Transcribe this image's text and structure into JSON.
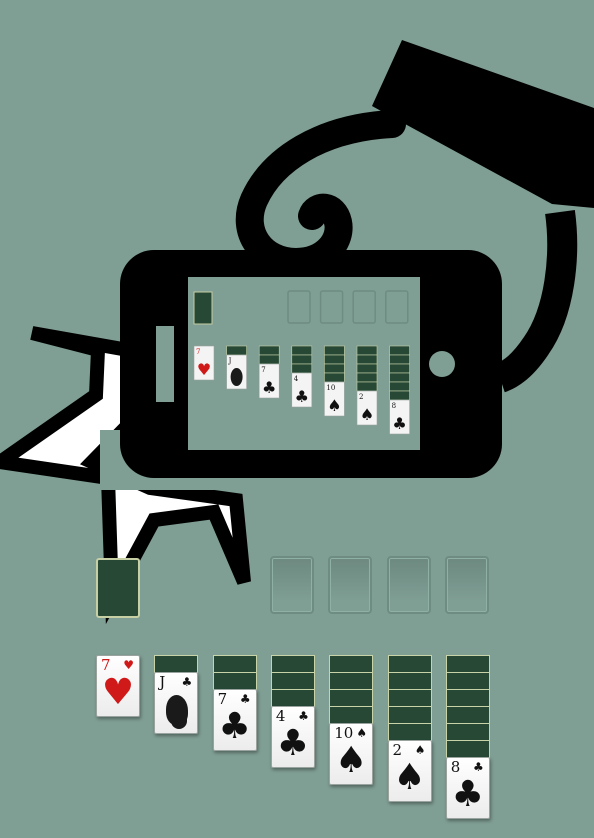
{
  "theme": {
    "felt": "#7f9e94",
    "card_back": "#264835",
    "red_suit": "#d01a1a",
    "black_suit": "#111111",
    "illustration": "#000000"
  },
  "illustration": {
    "icons": [
      "hand-holding-phone-icon",
      "smartphone-icon",
      "burst-icon"
    ]
  },
  "stock": {
    "label": "stock-pile"
  },
  "foundations": [
    {
      "name": "foundation-1"
    },
    {
      "name": "foundation-2"
    },
    {
      "name": "foundation-3"
    },
    {
      "name": "foundation-4"
    }
  ],
  "tableau": [
    {
      "hidden": 0,
      "card": {
        "rank": "7",
        "suit": "♥",
        "color": "red"
      }
    },
    {
      "hidden": 1,
      "card": {
        "rank": "J",
        "suit": "♣",
        "color": "black",
        "face": "jack"
      }
    },
    {
      "hidden": 2,
      "card": {
        "rank": "7",
        "suit": "♣",
        "color": "black"
      }
    },
    {
      "hidden": 3,
      "card": {
        "rank": "4",
        "suit": "♣",
        "color": "black"
      }
    },
    {
      "hidden": 4,
      "card": {
        "rank": "10",
        "suit": "♠",
        "color": "black"
      }
    },
    {
      "hidden": 5,
      "card": {
        "rank": "2",
        "suit": "♠",
        "color": "black"
      }
    },
    {
      "hidden": 6,
      "card": {
        "rank": "8",
        "suit": "♣",
        "color": "black"
      }
    }
  ]
}
